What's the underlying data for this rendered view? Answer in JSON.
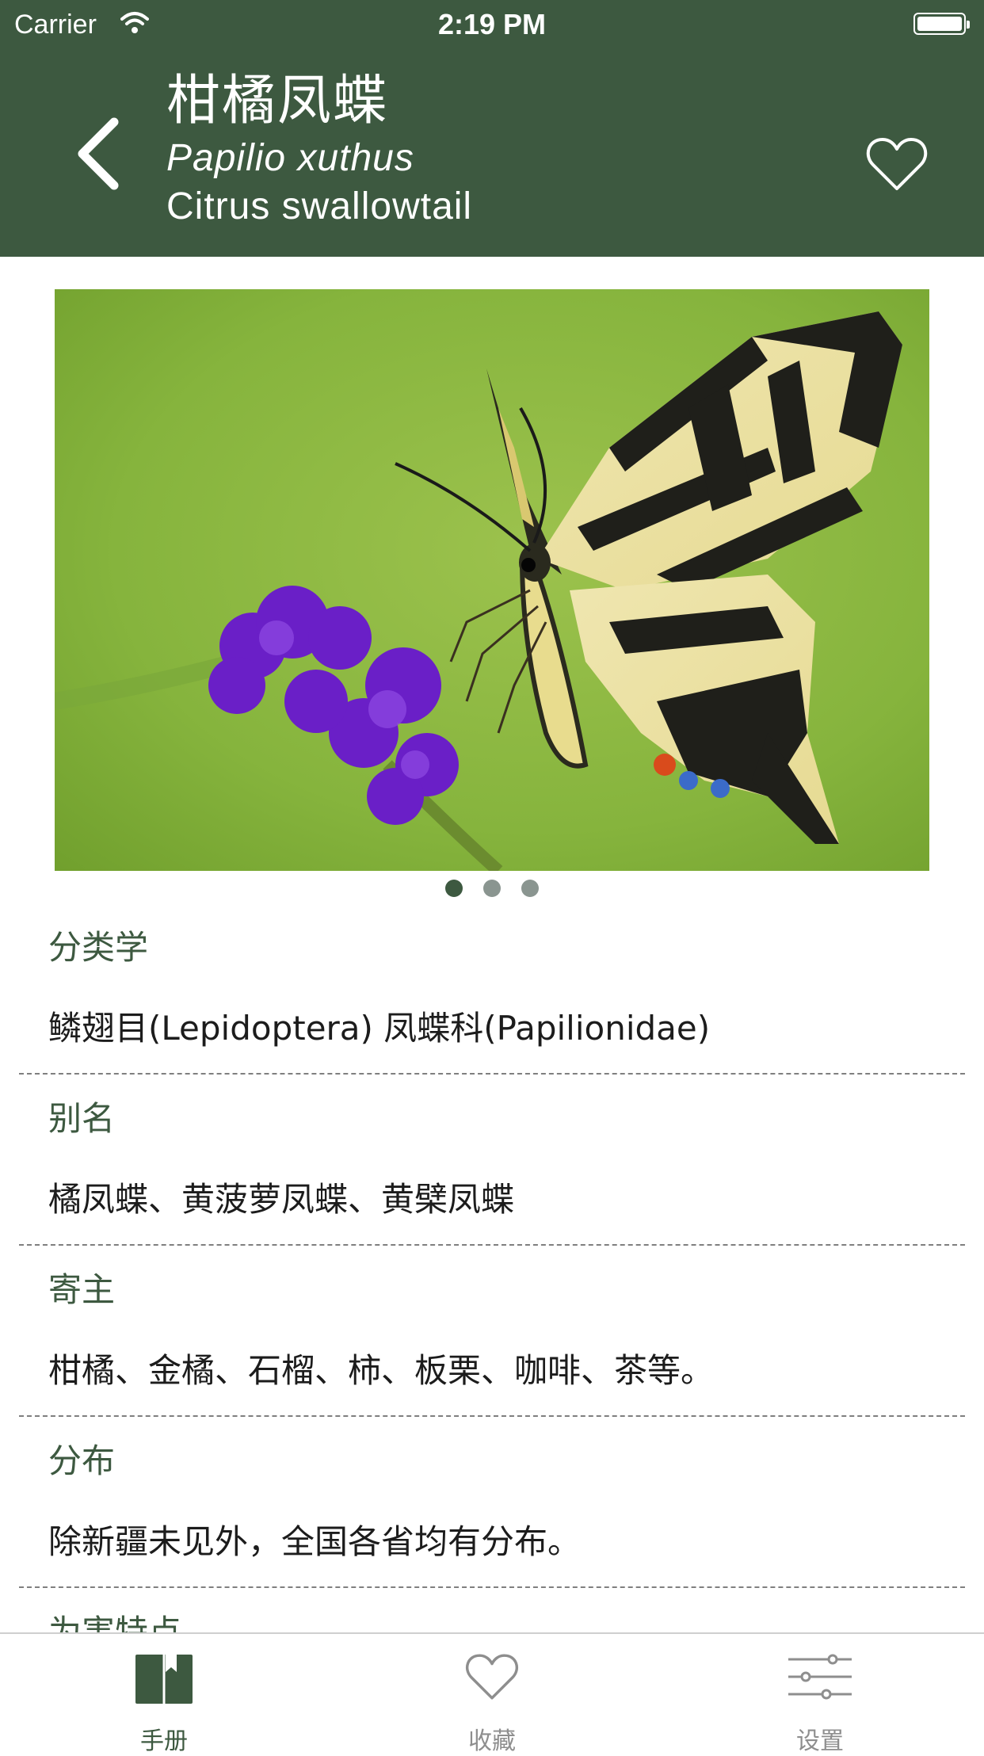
{
  "status_bar": {
    "carrier": "Carrier",
    "time": "2:19 PM"
  },
  "header": {
    "title_cn": "柑橘凤蝶",
    "title_latin": "Papilio xuthus",
    "title_en": "Citrus swallowtail",
    "back_icon": "chevron-left-icon",
    "favorite_icon": "heart-outline-icon"
  },
  "gallery": {
    "page_count": 3,
    "current_page": 1
  },
  "sections": [
    {
      "label": "分类学",
      "value": "鳞翅目(Lepidoptera) 凤蝶科(Papilionidae)"
    },
    {
      "label": "别名",
      "value": "橘凤蝶、黄菠萝凤蝶、黄檗凤蝶"
    },
    {
      "label": "寄主",
      "value": "柑橘、金橘、石榴、柿、板栗、咖啡、茶等。"
    },
    {
      "label": "分布",
      "value": "除新疆未见外，全国各省均有分布。"
    },
    {
      "label": "为害特点",
      "value": ""
    }
  ],
  "tabbar": {
    "tabs": [
      {
        "label": "手册",
        "icon": "book-icon",
        "active": true
      },
      {
        "label": "收藏",
        "icon": "heart-outline-icon",
        "active": false
      },
      {
        "label": "设置",
        "icon": "sliders-icon",
        "active": false
      }
    ]
  },
  "colors": {
    "primary": "#3d5940",
    "text": "#1c1c1c",
    "inactive": "#8e8e8e"
  }
}
